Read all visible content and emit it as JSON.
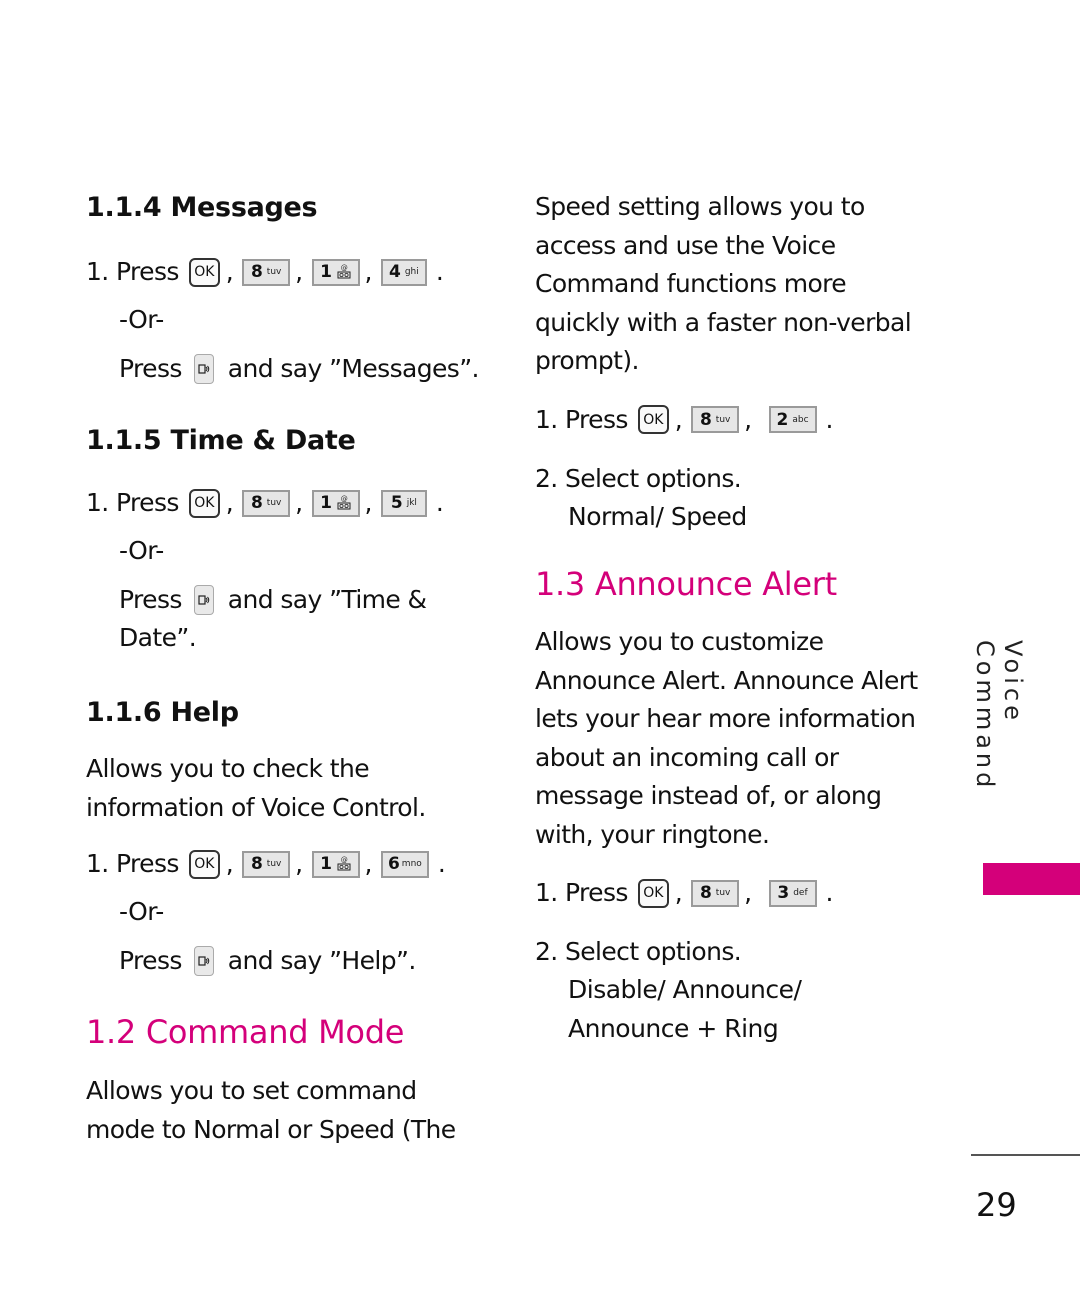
{
  "page": {
    "number": "29",
    "side_tab": {
      "label": "Voice Command",
      "color": "#D4007A"
    },
    "accent_color": "#D4007A"
  },
  "left_column": {
    "messages": {
      "heading": "1.1.4 Messages",
      "step1_prefix": "1. Press",
      "keys": [
        {
          "num": "8",
          "letters": "tuv"
        },
        {
          "num": "1",
          "letters": "voicemail"
        },
        {
          "num": "4",
          "letters": "ghi"
        }
      ],
      "or": "-Or-",
      "alt_prefix": "Press",
      "alt_suffix": "and say ”Messages”."
    },
    "time_date": {
      "heading": "1.1.5 Time & Date",
      "step1_prefix": "1. Press",
      "keys": [
        {
          "num": "8",
          "letters": "tuv"
        },
        {
          "num": "1",
          "letters": "voicemail"
        },
        {
          "num": "5",
          "letters": "jkl"
        }
      ],
      "or": "-Or-",
      "alt_prefix": "Press",
      "alt_suffix": "and say ”Time &",
      "alt_suffix_line2": "Date”."
    },
    "help": {
      "heading": "1.1.6 Help",
      "description_line1": "Allows you to check the",
      "description_line2": "information of Voice Control.",
      "step1_prefix": "1. Press",
      "keys": [
        {
          "num": "8",
          "letters": "tuv"
        },
        {
          "num": "1",
          "letters": "voicemail"
        },
        {
          "num": "6",
          "letters": "mno"
        }
      ],
      "or": "-Or-",
      "alt_prefix": "Press",
      "alt_suffix": "and say ”Help”."
    },
    "command_mode": {
      "heading": "1.2 Command Mode",
      "description_line1": "Allows you to set command",
      "description_line2": "mode to Normal or Speed (The"
    }
  },
  "right_column": {
    "command_mode_cont": {
      "lines": [
        "Speed setting allows you to",
        "access and use the Voice",
        "Command functions more",
        "quickly with a faster non-verbal",
        "prompt)."
      ],
      "step1_prefix": "1. Press",
      "keys": [
        {
          "num": "8",
          "letters": "tuv"
        },
        {
          "num": "2",
          "letters": "abc"
        }
      ],
      "step2": "2. Select options.",
      "options": "Normal/ Speed"
    },
    "announce_alert": {
      "heading": "1.3 Announce Alert",
      "lines": [
        "Allows you to customize",
        "Announce Alert. Announce Alert",
        "lets your hear more information",
        "about an incoming call or",
        "message instead of, or along",
        "with, your ringtone."
      ],
      "step1_prefix": "1. Press",
      "keys": [
        {
          "num": "8",
          "letters": "tuv"
        },
        {
          "num": "3",
          "letters": "def"
        }
      ],
      "step2": "2. Select options.",
      "options_line1": "Disable/ Announce/",
      "options_line2": "Announce + Ring"
    }
  },
  "keys": {
    "ok_label": "OK"
  },
  "punct": {
    "comma": ",",
    "period": "."
  }
}
